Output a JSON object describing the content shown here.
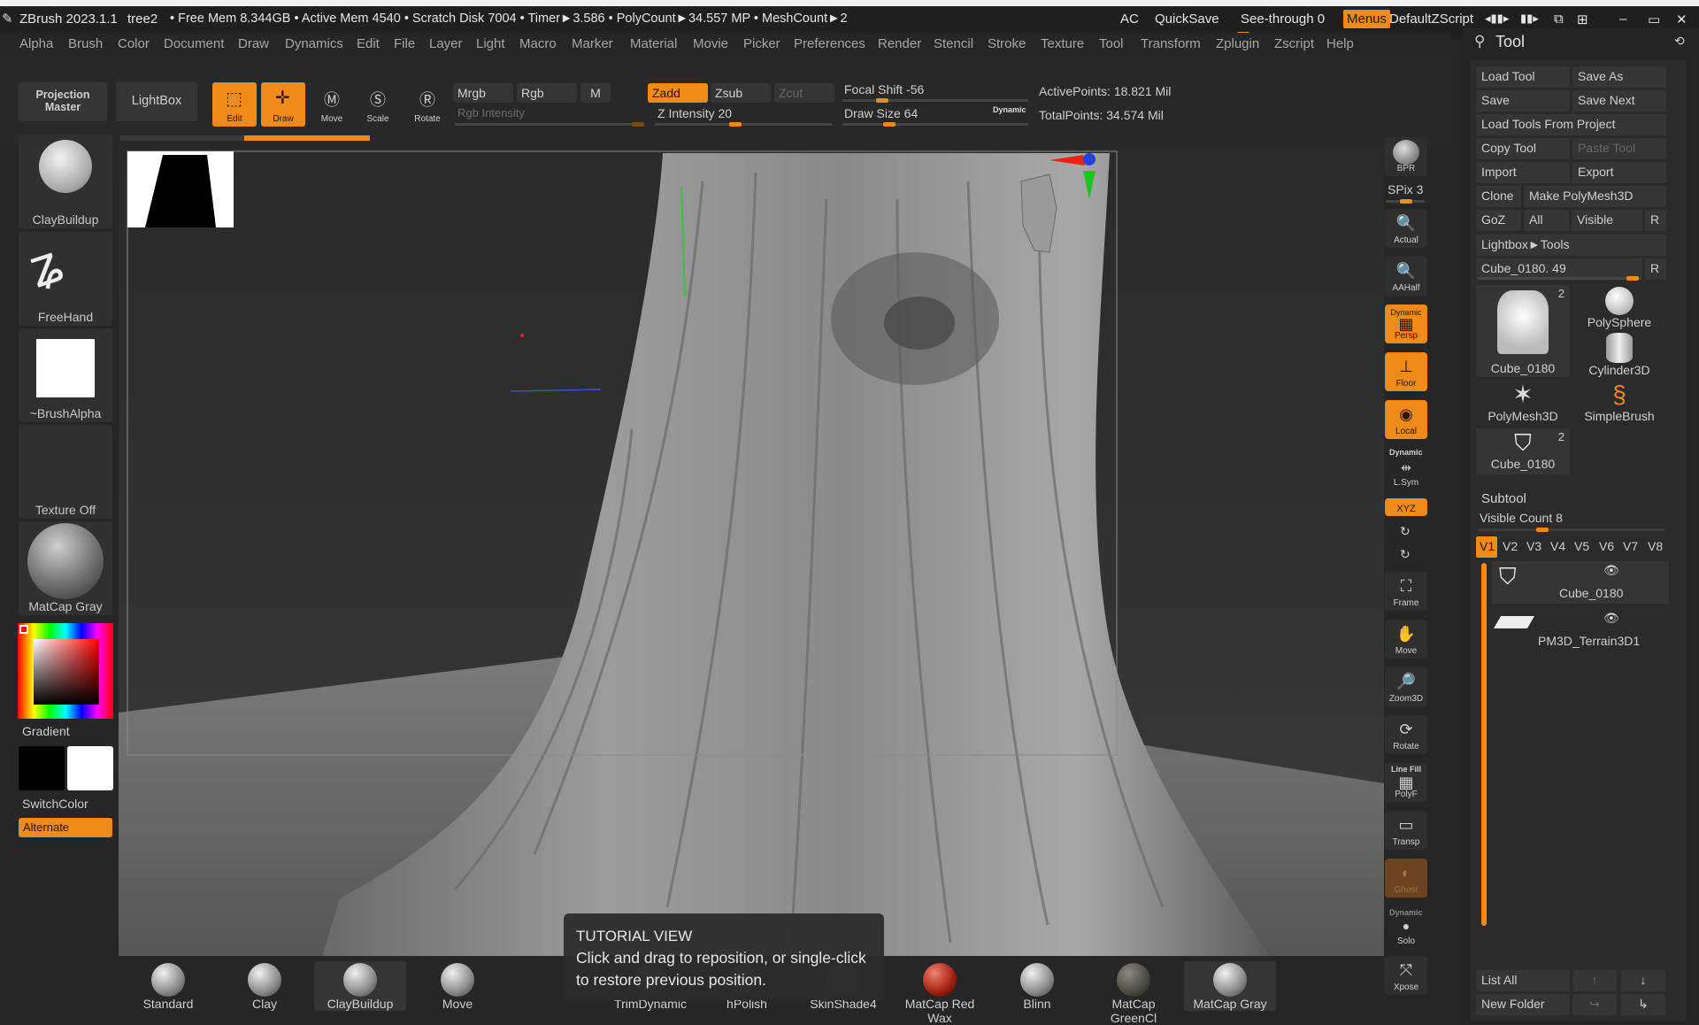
{
  "titlebar": {
    "app": "ZBrush 2023.1.1",
    "doc": "tree2",
    "stats": "• Free Mem 8.344GB • Active Mem 4540 • Scratch Disk 7004 •  Timer►3.586 • PolyCount►34.557 MP  • MeshCount►2",
    "ac": "AC",
    "quicksave": "QuickSave",
    "seethrough": "See-through  0",
    "menus": "Menus",
    "defaultzscript": "DefaultZScript"
  },
  "menu": [
    "Alpha",
    "Brush",
    "Color",
    "Document",
    "Draw",
    "Dynamics",
    "Edit",
    "File",
    "Layer",
    "Light",
    "Macro",
    "Marker",
    "Material",
    "Movie",
    "Picker",
    "Preferences",
    "Render",
    "Stencil",
    "Stroke",
    "Texture",
    "Tool",
    "Transform",
    "Zplugin",
    "Zscript",
    "Help"
  ],
  "toolbar": {
    "projection_master": "Projection Master",
    "lightbox": "LightBox",
    "edit": "Edit",
    "draw": "Draw",
    "move": "Move",
    "scale": "Scale",
    "rotate": "Rotate",
    "mrgb": "Mrgb",
    "rgb": "Rgb",
    "m": "M",
    "rgb_intensity": "Rgb Intensity",
    "zadd": "Zadd",
    "zsub": "Zsub",
    "zcut": "Zcut",
    "z_intensity": "Z Intensity 20",
    "focal_shift": "Focal Shift -56",
    "draw_size": "Draw Size 64",
    "dynamic": "Dynamic",
    "active_points": "ActivePoints: 18.821 Mil",
    "total_points": "TotalPoints: 34.574 Mil"
  },
  "leftshelf": {
    "brush": "ClayBuildup",
    "stroke": "FreeHand",
    "alpha": "~BrushAlpha",
    "texture": "Texture Off",
    "material": "MatCap Gray",
    "gradient": "Gradient",
    "switchcolor": "SwitchColor",
    "alternate": "Alternate"
  },
  "rightshelf": [
    "BPR",
    "SPix 3",
    "Actual",
    "AAHalf",
    "Persp",
    "Floor",
    "Local",
    "L.Sym",
    "XYZ",
    "Frame",
    "Move",
    "Zoom3D",
    "Rotate",
    "PolyF",
    "Transp",
    "Ghost",
    "Solo",
    "Xpose"
  ],
  "rightshelf_extra": {
    "dynamic": "Dynamic",
    "linefill": "Line Fill"
  },
  "toolpanel": {
    "title": "Tool",
    "load_tool": "Load Tool",
    "save_as": "Save As",
    "save": "Save",
    "save_next": "Save Next",
    "load_tools_from_project": "Load Tools From Project",
    "copy_tool": "Copy Tool",
    "paste_tool": "Paste Tool",
    "import": "Import",
    "export": "Export",
    "clone": "Clone",
    "make_polymesh": "Make PolyMesh3D",
    "goz": "GoZ",
    "all": "All",
    "visible": "Visible",
    "r": "R",
    "lightbox_tools": "Lightbox►Tools",
    "current_tool": "Cube_0180. 49",
    "tiles": [
      {
        "name": "Cube_0180",
        "badge": "2"
      },
      {
        "name": "PolySphere",
        "badge": ""
      },
      {
        "name": "Cylinder3D",
        "badge": ""
      },
      {
        "name": "PolyMesh3D",
        "badge": ""
      },
      {
        "name": "SimpleBrush",
        "badge": ""
      },
      {
        "name": "Cube_0180",
        "badge": "2"
      }
    ],
    "subtool_title": "Subtool",
    "visible_count": "Visible Count 8",
    "versions": [
      "V1",
      "V2",
      "V3",
      "V4",
      "V5",
      "V6",
      "V7",
      "V8"
    ],
    "subtools": [
      "Cube_0180",
      "PM3D_Terrain3D1"
    ],
    "list_all": "List All",
    "new_folder": "New Folder"
  },
  "bottomshelf": [
    "Standard",
    "Clay",
    "ClayBuildup",
    "Move",
    "TrimDynamic",
    "hPolish",
    "SkinShade4",
    "MatCap Red Wax",
    "Blinn",
    "MatCap GreenCl",
    "MatCap Gray"
  ],
  "tutorial": {
    "title": "TUTORIAL VIEW",
    "body": "Click and drag to reposition, or single-click to restore previous position."
  },
  "colors": {
    "accent": "#f08a18",
    "panel": "#282828",
    "button": "#353535"
  }
}
